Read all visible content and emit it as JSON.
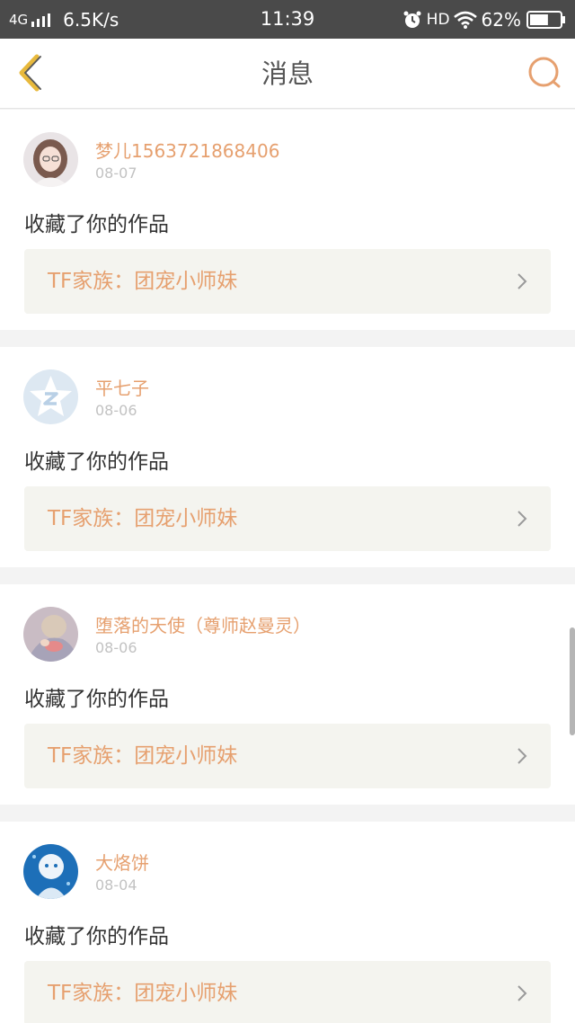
{
  "status_bar": {
    "network": "4G",
    "speed": "6.5K/s",
    "time": "11:39",
    "hd": "HD",
    "battery_percent": "62%",
    "battery_level": 0.62,
    "icons": [
      "signal-icon",
      "alarm-icon",
      "wifi-icon",
      "battery-icon"
    ]
  },
  "nav": {
    "title": "消息",
    "back_icon": "chevron-left-icon",
    "search_icon": "search-icon"
  },
  "colors": {
    "accent": "#e6a06f",
    "nav_icon": "#e8b93c",
    "text": "#333333",
    "muted": "#c2c2c2",
    "link_bg": "#f4f4ef"
  },
  "messages": [
    {
      "username": "梦儿1563721868406",
      "date": "08-07",
      "action": "收藏了你的作品",
      "work_title": "TF家族：团宠小师妹"
    },
    {
      "username": "平七子",
      "date": "08-06",
      "action": "收藏了你的作品",
      "work_title": "TF家族：团宠小师妹"
    },
    {
      "username": "堕落的天使（尊师赵曼灵）",
      "date": "08-06",
      "action": "收藏了你的作品",
      "work_title": "TF家族：团宠小师妹"
    },
    {
      "username": "大烙饼",
      "date": "08-04",
      "action": "收藏了你的作品",
      "work_title": "TF家族：团宠小师妹"
    }
  ]
}
